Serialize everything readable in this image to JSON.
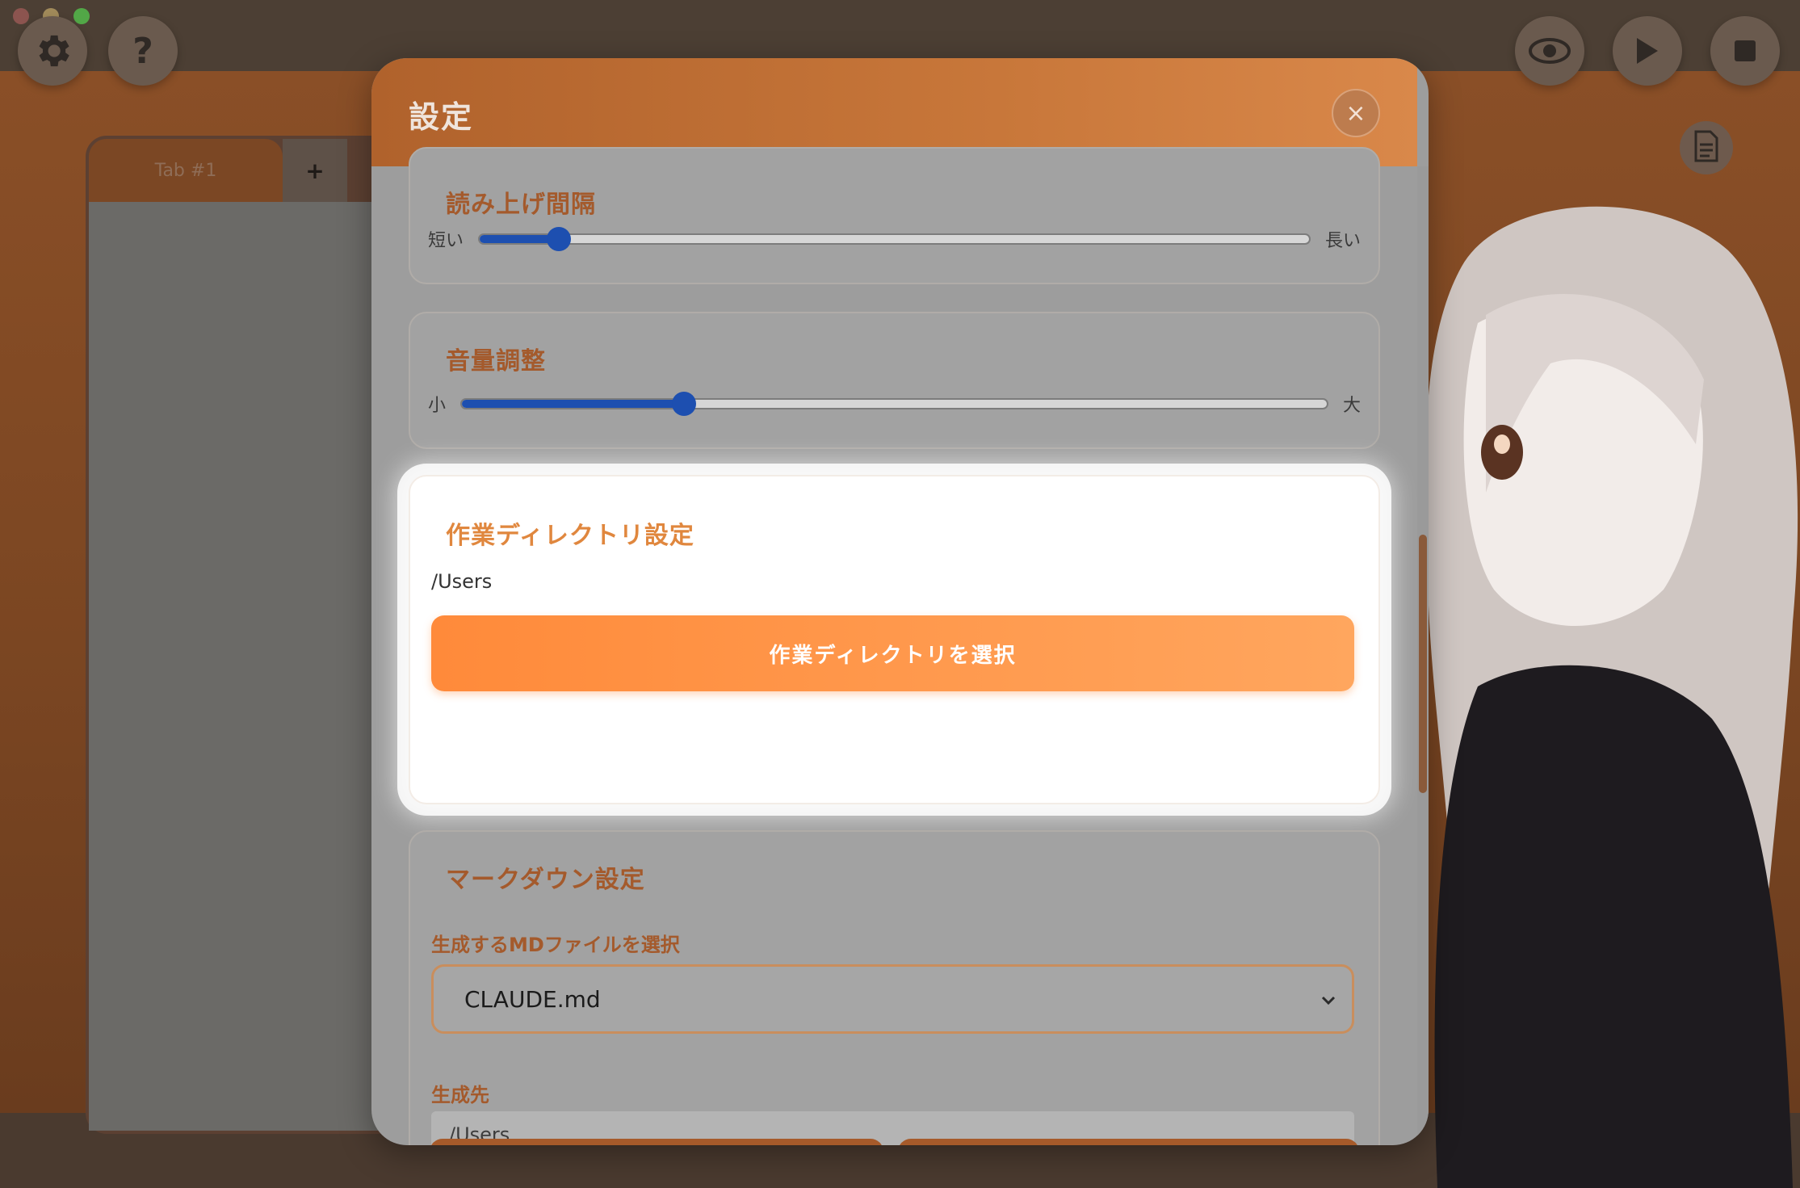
{
  "window": {
    "traffic_lights": [
      "#ec6a5e",
      "#f4bf4f",
      "#61c554"
    ]
  },
  "toolbar": {
    "settings_icon": "gear-icon",
    "help_icon": "question-icon",
    "help_label": "?",
    "view_icon": "eye-icon",
    "play_icon": "play-icon",
    "stop_icon": "stop-icon",
    "doc_icon": "document-icon"
  },
  "tabs": {
    "items": [
      {
        "label": "Tab #1"
      }
    ],
    "add_label": "+"
  },
  "modal": {
    "title": "設定",
    "close_label": "×",
    "reading_interval": {
      "title": "読み上げ間隔",
      "min_label": "短い",
      "max_label": "長い",
      "value_fraction": 0.095
    },
    "volume": {
      "title": "音量調整",
      "min_label": "小",
      "max_label": "大",
      "value_fraction": 0.257
    },
    "workdir": {
      "title": "作業ディレクトリ設定",
      "path": "/Users",
      "select_button": "作業ディレクトリを選択"
    },
    "markdown": {
      "title": "マークダウン設定",
      "file_label": "生成するMDファイルを選択",
      "file_value": "CLAUDE.md",
      "dest_label": "生成先",
      "dest_value": "/Users"
    }
  },
  "colors": {
    "accent": "#ff8a3a",
    "slider": "#1d4fb0",
    "header": "#c8773a"
  }
}
